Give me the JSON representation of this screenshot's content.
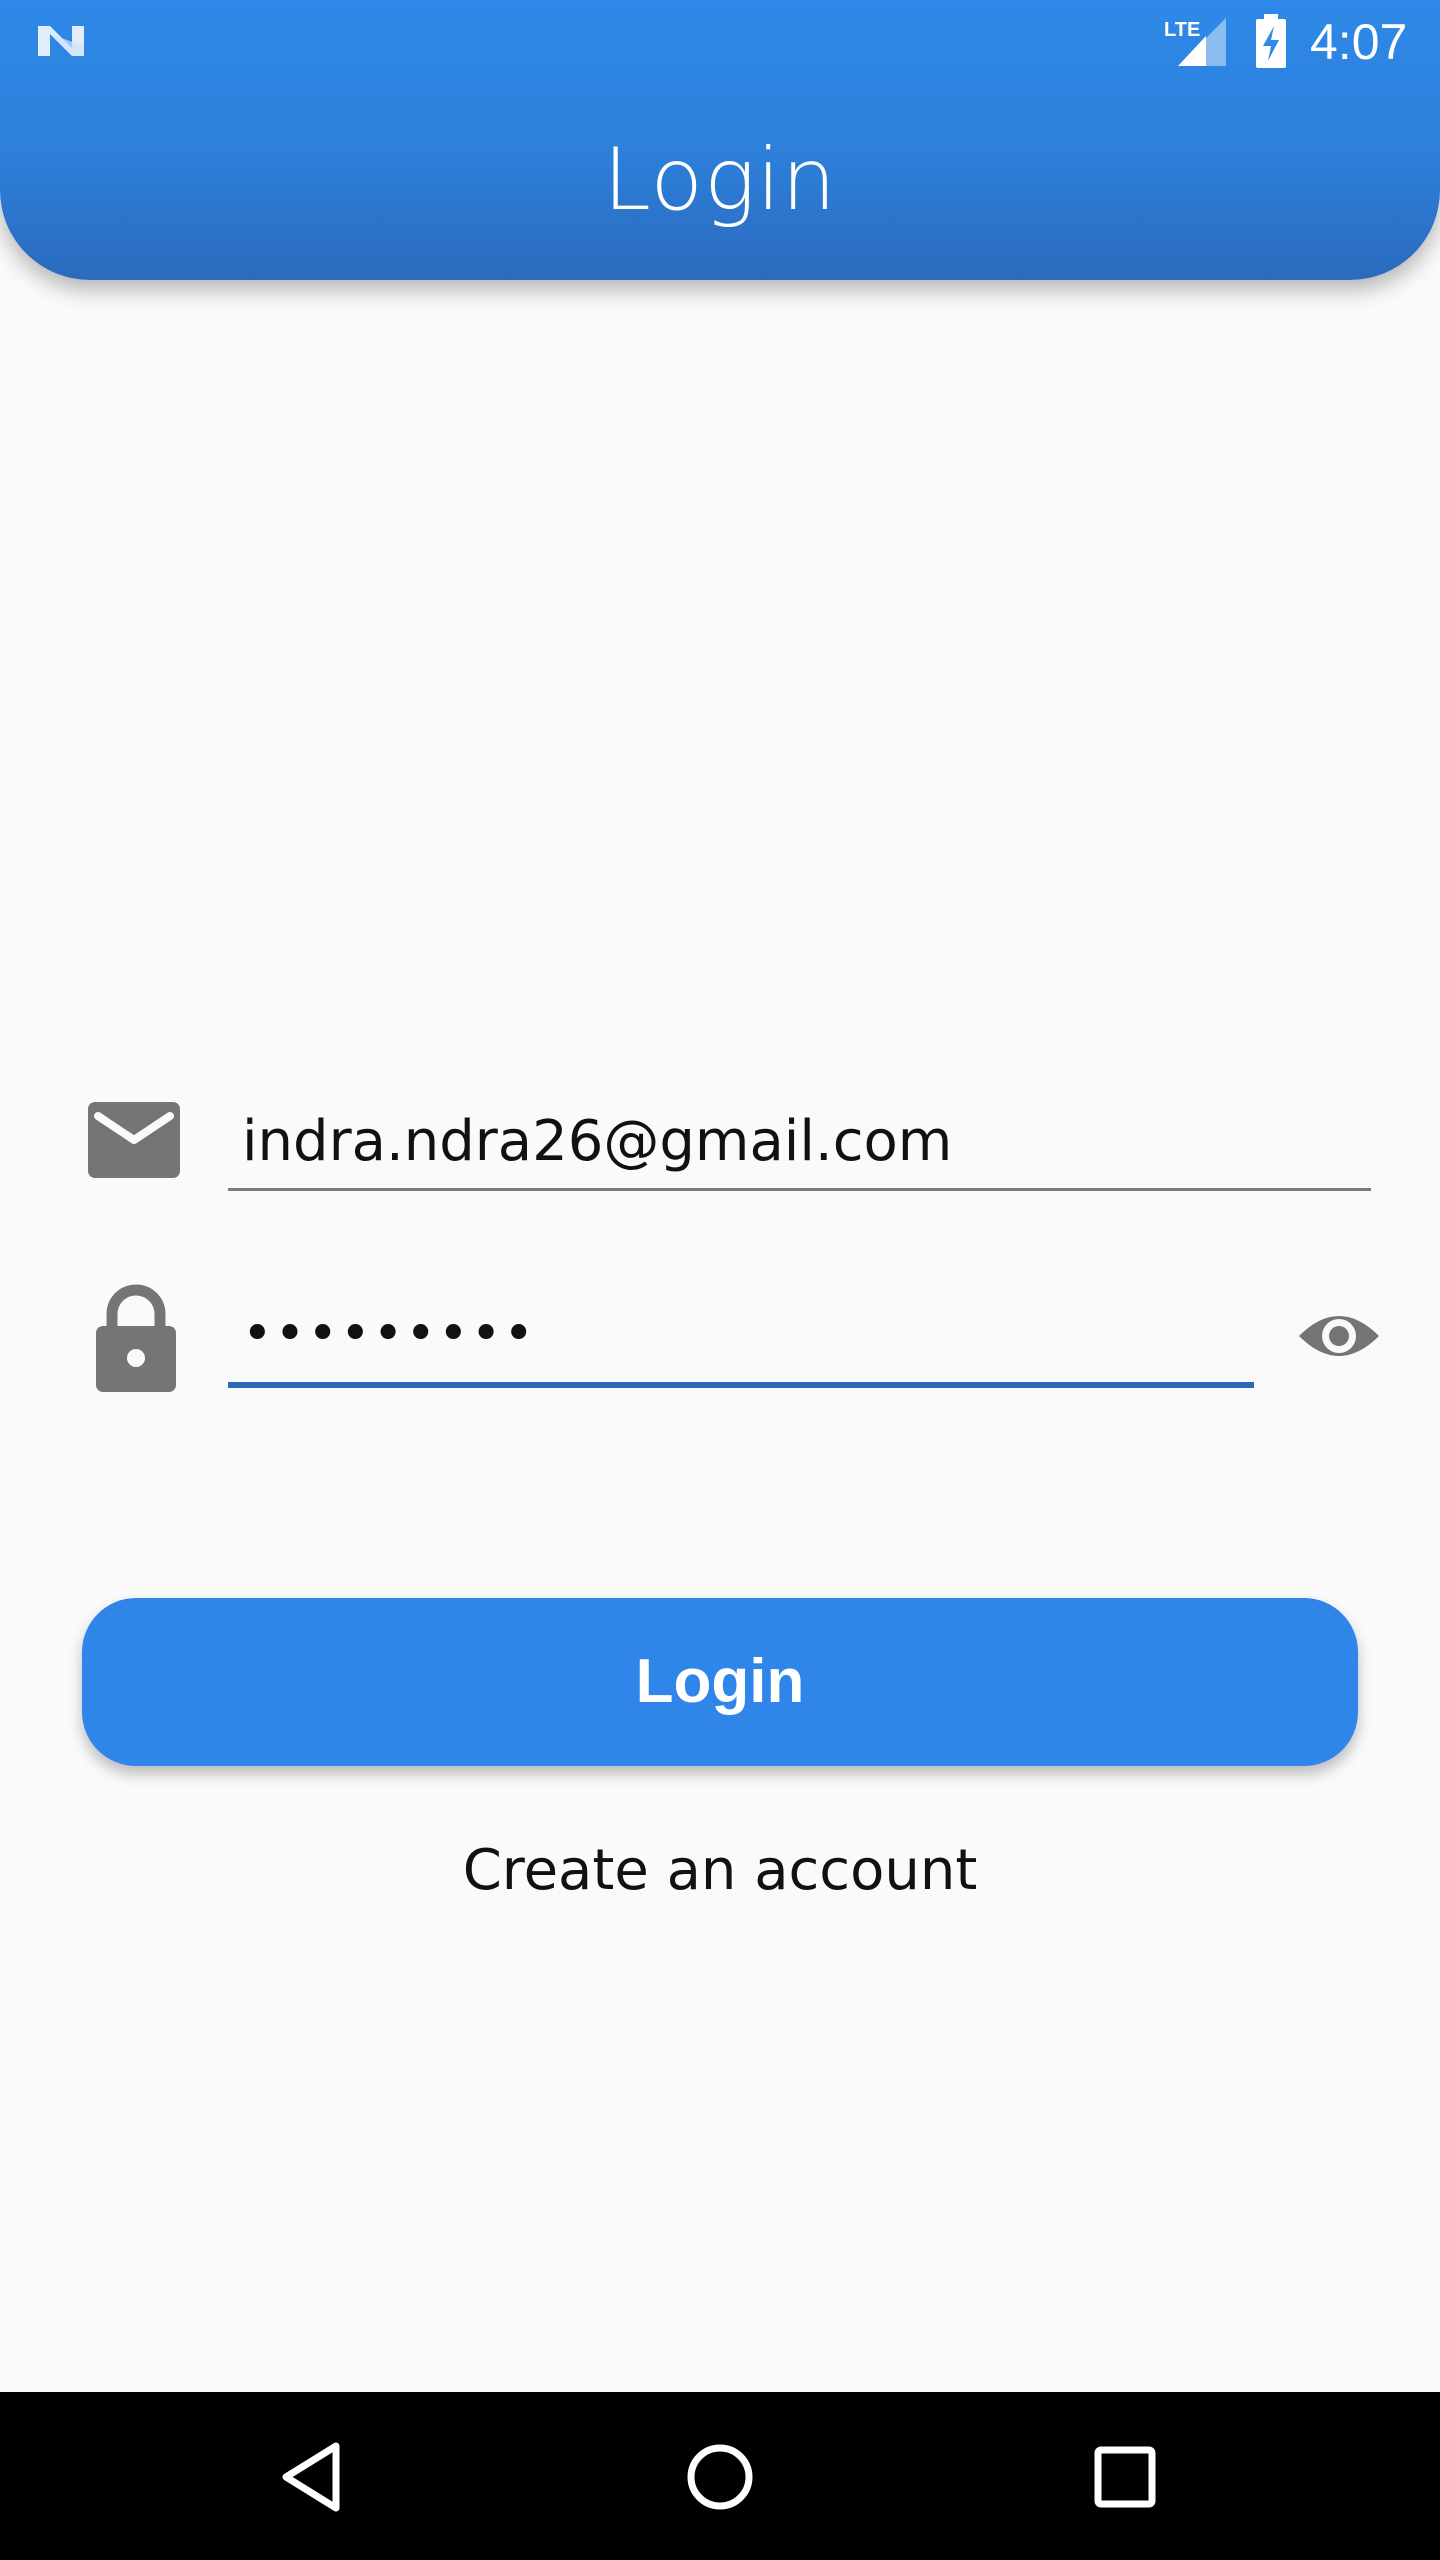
{
  "status_bar": {
    "time": "4:07",
    "network": "LTE",
    "icons": [
      "n-logo-icon",
      "lte-signal-icon",
      "battery-charging-icon"
    ]
  },
  "app_bar": {
    "title": "Login",
    "gradient": [
      "#2f89e8",
      "#2a6bbd"
    ]
  },
  "form": {
    "email": {
      "icon": "mail-icon",
      "value": "indra.ndra26@gmail.com"
    },
    "password": {
      "icon": "lock-icon",
      "value": "•••••••••",
      "toggle_icon": "eye-icon",
      "focused": true
    }
  },
  "actions": {
    "login_label": "Login",
    "create_account_label": "Create an account"
  },
  "nav_bar": {
    "buttons": [
      "back-icon",
      "home-icon",
      "recents-icon"
    ]
  },
  "colors": {
    "primary": "#2f86e8",
    "focus_underline": "#2a68b8",
    "icon_gray": "#757575",
    "background": "#fafafa"
  }
}
